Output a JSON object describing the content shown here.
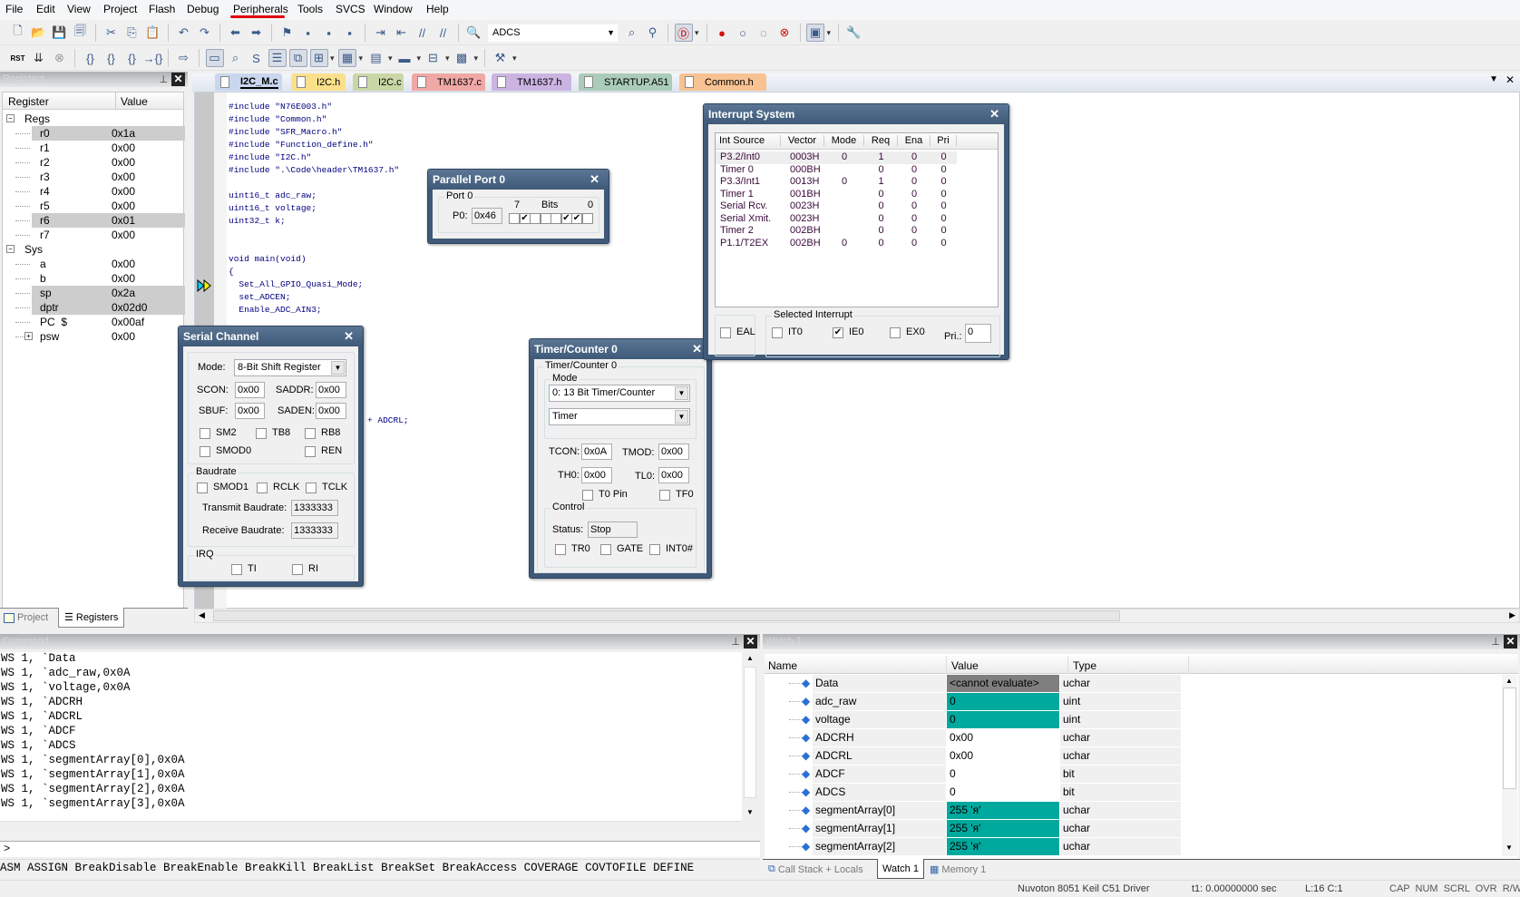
{
  "menu": [
    "File",
    "Edit",
    "View",
    "Project",
    "Flash",
    "Debug",
    "Peripherals",
    "Tools",
    "SVCS",
    "Window",
    "Help"
  ],
  "toolbar1": {
    "icons_a": [
      "new-file-icon",
      "open-folder-icon",
      "save-icon",
      "save-all-icon",
      "|",
      "cut-icon",
      "copy-icon",
      "paste-icon",
      "|",
      "undo-icon",
      "redo-icon",
      "|",
      "navigate-back-icon",
      "navigate-forward-icon",
      "|",
      "bookmark-icon",
      "prev-bookmark-icon",
      "next-bookmark-icon",
      "clear-bookmarks-icon",
      "|",
      "indent-icon",
      "unindent-icon",
      "comment-icon",
      "uncomment-icon",
      "|",
      "find-in-files-icon"
    ],
    "target": "ADCS",
    "icons_b": [
      "incremental-find-icon",
      "source-browser-icon",
      "|",
      "debug-session-icon",
      "|",
      "insert-breakpoint-icon",
      "enable-breakpoint-icon",
      "disable-breakpoints-icon",
      "kill-breakpoints-icon",
      "|",
      "window-layout-icon",
      "|",
      "configure-icon"
    ]
  },
  "toolbar2": {
    "icons": [
      "reset-cpu-icon",
      "run-icon",
      "stop-icon",
      "|",
      "step-into-icon",
      "step-over-icon",
      "step-out-icon",
      "run-to-cursor-icon",
      "|",
      "show-next-statement-icon",
      "|",
      "command-window-icon",
      "disassembly-window-icon",
      "symbols-window-icon",
      "registers-window-icon",
      "call-stack-window-icon",
      "watch-window-icon",
      "memory-window-icon",
      "serial-window-icon",
      "analysis-window-icon",
      "trace-window-icon",
      "system-viewer-icon",
      "|",
      "toolbox-icon"
    ]
  },
  "registers": {
    "title": "Registers",
    "col_register": "Register",
    "col_value": "Value",
    "rows": [
      {
        "name": "Regs",
        "value": "",
        "level": 0,
        "expander": "−",
        "hl": false
      },
      {
        "name": "r0",
        "value": "0x1a",
        "level": 1,
        "hl": true
      },
      {
        "name": "r1",
        "value": "0x00",
        "level": 1,
        "hl": false
      },
      {
        "name": "r2",
        "value": "0x00",
        "level": 1,
        "hl": false
      },
      {
        "name": "r3",
        "value": "0x00",
        "level": 1,
        "hl": false
      },
      {
        "name": "r4",
        "value": "0x00",
        "level": 1,
        "hl": false
      },
      {
        "name": "r5",
        "value": "0x00",
        "level": 1,
        "hl": false
      },
      {
        "name": "r6",
        "value": "0x01",
        "level": 1,
        "hl": true
      },
      {
        "name": "r7",
        "value": "0x00",
        "level": 1,
        "hl": false
      },
      {
        "name": "Sys",
        "value": "",
        "level": 0,
        "expander": "−",
        "hl": false
      },
      {
        "name": "a",
        "value": "0x00",
        "level": 1,
        "hl": false
      },
      {
        "name": "b",
        "value": "0x00",
        "level": 1,
        "hl": false
      },
      {
        "name": "sp",
        "value": "0x2a",
        "level": 1,
        "hl": true
      },
      {
        "name": "dptr",
        "value": "0x02d0",
        "level": 1,
        "hl": true
      },
      {
        "name": "PC  $",
        "value": "0x00af",
        "level": 1,
        "hl": false
      },
      {
        "name": "psw",
        "value": "0x00",
        "level": 1,
        "expander": "+",
        "hl": false
      }
    ],
    "tabs": [
      "Project",
      "Registers"
    ]
  },
  "editor": {
    "tabs": [
      {
        "label": "I2C_M.c",
        "color": "#c8d6ee",
        "active": true
      },
      {
        "label": "I2C.h",
        "color": "#fbe08c",
        "active": false
      },
      {
        "label": "I2C.c",
        "color": "#c9d7a6",
        "active": false
      },
      {
        "label": "TM1637.c",
        "color": "#f0a8a6",
        "active": false
      },
      {
        "label": "TM1637.h",
        "color": "#cbb4e2",
        "active": false
      },
      {
        "label": "STARTUP.A51",
        "color": "#abccba",
        "active": false
      },
      {
        "label": "Common.h",
        "color": "#f8c292",
        "active": false
      }
    ],
    "code_lines": [
      "#include \"N76E003.h\"",
      "#include \"Common.h\"",
      "#include \"SFR_Macro.h\"",
      "#include \"Function_define.h\"",
      "#include \"I2C.h\"",
      "#include \".\\Code\\header\\TM1637.h\"",
      "",
      "uint16_t adc_raw;",
      "uint16_t voltage;",
      "uint32_t k;",
      "",
      "",
      "void main(void)",
      "{",
      "  Set_All_GPIO_Quasi_Mode;",
      "  set_ADCEN;",
      "  Enable_ADC_AIN3;"
    ],
    "current_line_index": 14,
    "visible_fragment": "+ ADCRL;"
  },
  "parallel_port": {
    "title": "Parallel Port 0",
    "group": "Port 0",
    "label": "P0:",
    "value": "0x46",
    "bits_label": "Bits",
    "bit_high": "7",
    "bit_low": "0",
    "bits": [
      false,
      true,
      false,
      false,
      false,
      true,
      true,
      false
    ]
  },
  "serial": {
    "title": "Serial Channel",
    "mode_label": "Mode:",
    "mode_value": "8-Bit Shift Register",
    "scon_label": "SCON:",
    "scon": "0x00",
    "saddr_label": "SADDR:",
    "saddr": "0x00",
    "sbuf_label": "SBUF:",
    "sbuf": "0x00",
    "saden_label": "SADEN:",
    "saden": "0x00",
    "checks1": [
      {
        "label": "SM2",
        "checked": false
      },
      {
        "label": "TB8",
        "checked": false
      },
      {
        "label": "RB8",
        "checked": false
      },
      {
        "label": "SMOD0",
        "checked": false
      },
      {
        "label": "REN",
        "checked": false
      }
    ],
    "baudrate_group": "Baudrate",
    "checks2": [
      {
        "label": "SMOD1",
        "checked": false
      },
      {
        "label": "RCLK",
        "checked": false
      },
      {
        "label": "TCLK",
        "checked": false
      }
    ],
    "tx_label": "Transmit Baudrate:",
    "tx": "1333333",
    "rx_label": "Receive Baudrate:",
    "rx": "1333333",
    "irq_group": "IRQ",
    "irq": [
      {
        "label": "TI",
        "checked": false
      },
      {
        "label": "RI",
        "checked": false
      }
    ]
  },
  "timer": {
    "title": "Timer/Counter 0",
    "group": "Timer/Counter 0",
    "mode_group": "Mode",
    "mode_value": "0: 13 Bit Timer/Counter",
    "type_value": "Timer",
    "tcon_label": "TCON:",
    "tcon": "0x0A",
    "tmod_label": "TMOD:",
    "tmod": "0x00",
    "th0_label": "TH0:",
    "th0": "0x00",
    "tl0_label": "TL0:",
    "tl0": "0x00",
    "t0pin": {
      "label": "T0 Pin",
      "checked": false
    },
    "tf0": {
      "label": "TF0",
      "checked": false
    },
    "control_group": "Control",
    "status_label": "Status:",
    "status": "Stop",
    "controls": [
      {
        "label": "TR0",
        "checked": false
      },
      {
        "label": "GATE",
        "checked": false
      },
      {
        "label": "INT0#",
        "checked": false
      }
    ]
  },
  "interrupt": {
    "title": "Interrupt System",
    "columns": [
      "Int Source",
      "Vector",
      "Mode",
      "Req",
      "Ena",
      "Pri"
    ],
    "rows": [
      [
        "P3.2/Int0",
        "0003H",
        "0",
        "1",
        "0",
        "0"
      ],
      [
        "Timer 0",
        "000BH",
        "",
        "0",
        "0",
        "0"
      ],
      [
        "P3.3/Int1",
        "0013H",
        "0",
        "1",
        "0",
        "0"
      ],
      [
        "Timer 1",
        "001BH",
        "",
        "0",
        "0",
        "0"
      ],
      [
        "Serial Rcv.",
        "0023H",
        "",
        "0",
        "0",
        "0"
      ],
      [
        "Serial Xmit.",
        "0023H",
        "",
        "0",
        "0",
        "0"
      ],
      [
        "Timer 2",
        "002BH",
        "",
        "0",
        "0",
        "0"
      ],
      [
        "P1.1/T2EX",
        "002BH",
        "0",
        "0",
        "0",
        "0"
      ]
    ],
    "selected_row": 0,
    "eal": {
      "label": "EAL",
      "checked": false
    },
    "selected_group": "Selected Interrupt",
    "it0": {
      "label": "IT0",
      "checked": false
    },
    "ie0": {
      "label": "IE0",
      "checked": true
    },
    "ex0": {
      "label": "EX0",
      "checked": false
    },
    "pri_label": "Pri.:",
    "pri": "0"
  },
  "command": {
    "title": "Command",
    "lines": [
      "WS 1, `Data",
      "WS 1, `adc_raw,0x0A",
      "WS 1, `voltage,0x0A",
      "WS 1, `ADCRH",
      "WS 1, `ADCRL",
      "WS 1, `ADCF",
      "WS 1, `ADCS",
      "WS 1, `segmentArray[0],0x0A",
      "WS 1, `segmentArray[1],0x0A",
      "WS 1, `segmentArray[2],0x0A",
      "WS 1, `segmentArray[3],0x0A"
    ],
    "prompt": ">",
    "input_value": "",
    "hint": "ASM ASSIGN BreakDisable BreakEnable BreakKill BreakList BreakSet BreakAccess COVERAGE COVTOFILE DEFINE"
  },
  "watch": {
    "title": "Watch 1",
    "columns": [
      "Name",
      "Value",
      "Type"
    ],
    "highlight_color": "#00a99d",
    "rows": [
      {
        "name": "Data",
        "value": "<cannot evaluate>",
        "type": "uchar",
        "state": "error"
      },
      {
        "name": "adc_raw",
        "value": "0",
        "type": "uint",
        "state": "changed"
      },
      {
        "name": "voltage",
        "value": "0",
        "type": "uint",
        "state": "changed"
      },
      {
        "name": "ADCRH",
        "value": "0x00",
        "type": "uchar",
        "state": "normal"
      },
      {
        "name": "ADCRL",
        "value": "0x00",
        "type": "uchar",
        "state": "normal"
      },
      {
        "name": "ADCF",
        "value": "0",
        "type": "bit",
        "state": "normal"
      },
      {
        "name": "ADCS",
        "value": "0",
        "type": "bit",
        "state": "normal"
      },
      {
        "name": "segmentArray[0]",
        "value": "255 'я'",
        "type": "uchar",
        "state": "changed"
      },
      {
        "name": "segmentArray[1]",
        "value": "255 'я'",
        "type": "uchar",
        "state": "changed"
      },
      {
        "name": "segmentArray[2]",
        "value": "255 'я'",
        "type": "uchar",
        "state": "changed"
      }
    ],
    "tabs": [
      "Call Stack + Locals",
      "Watch 1",
      "Memory 1"
    ],
    "active_tab": 1
  },
  "status": {
    "driver": "Nuvoton 8051 Keil C51 Driver",
    "time": "t1: 0.00000000 sec",
    "position": "L:16 C:1",
    "indicators": "CAP  NUM  SCRL  OVR  R/W"
  }
}
